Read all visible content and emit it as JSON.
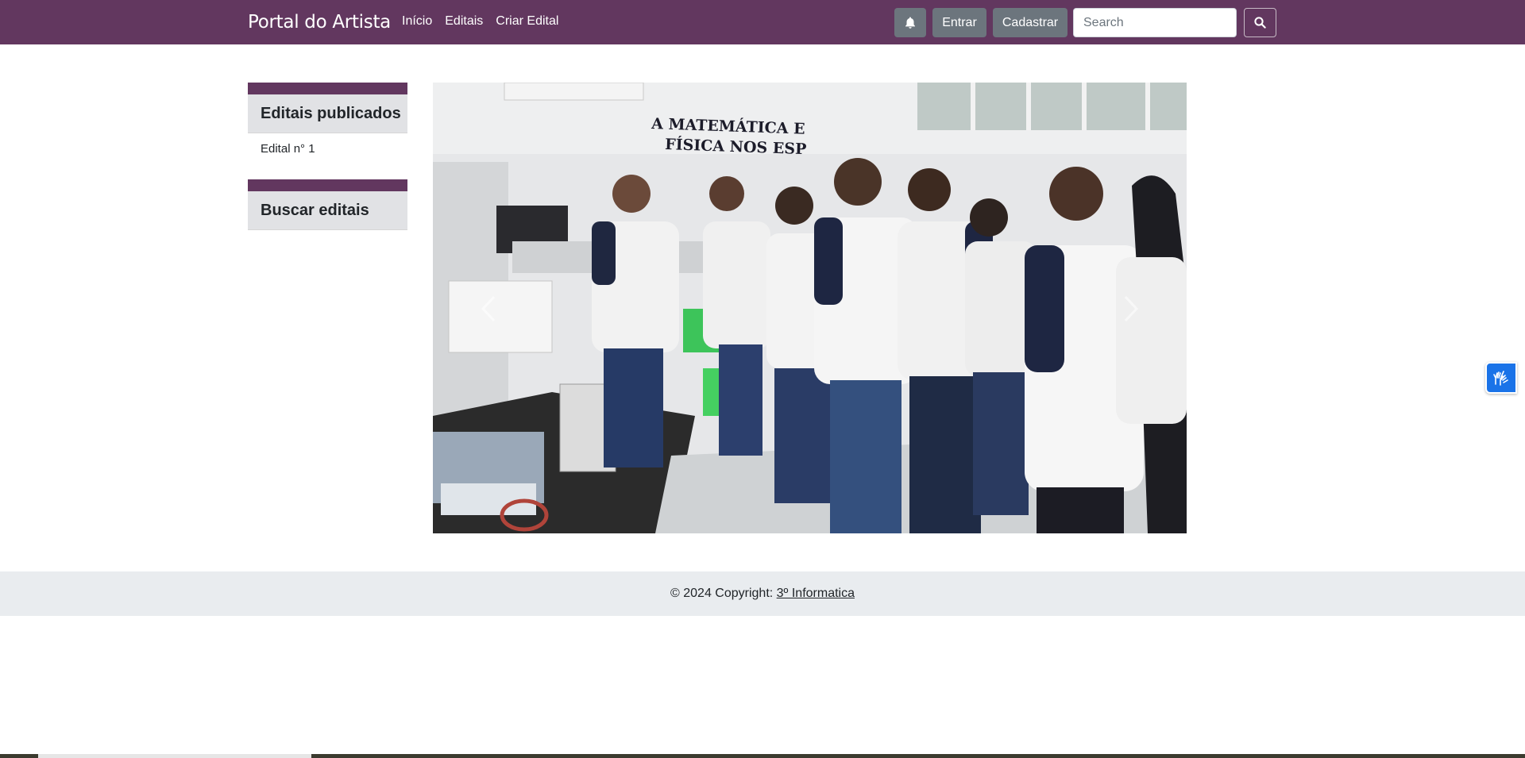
{
  "navbar": {
    "brand": "Portal do Artista",
    "links": [
      "Início",
      "Editais",
      "Criar Edital"
    ],
    "bell_icon": "bell-icon",
    "entrar_label": "Entrar",
    "cadastrar_label": "Cadastrar",
    "search_placeholder": "Search",
    "search_value": "",
    "search_icon": "search-icon"
  },
  "sidebar": {
    "published": {
      "title": "Editais publicados",
      "items": [
        "Edital n° 1"
      ]
    },
    "search": {
      "title": "Buscar editais"
    }
  },
  "carousel": {
    "image_text_line1": "A MATEMÁTICA E",
    "image_text_line2": "FÍSICA NOS ESP",
    "prev_icon": "chevron-left-icon",
    "next_icon": "chevron-right-icon"
  },
  "footer": {
    "copyright": "© 2024 Copyright: ",
    "link": "3º Informatica"
  },
  "vlibras": {
    "icon": "sign-language-hands-icon"
  },
  "colors": {
    "navbar": "#62375f",
    "button_gray": "#6c757d",
    "card_header": "#e1e2e5",
    "footer": "#e9ecef",
    "vlibras": "#1a73e8"
  }
}
